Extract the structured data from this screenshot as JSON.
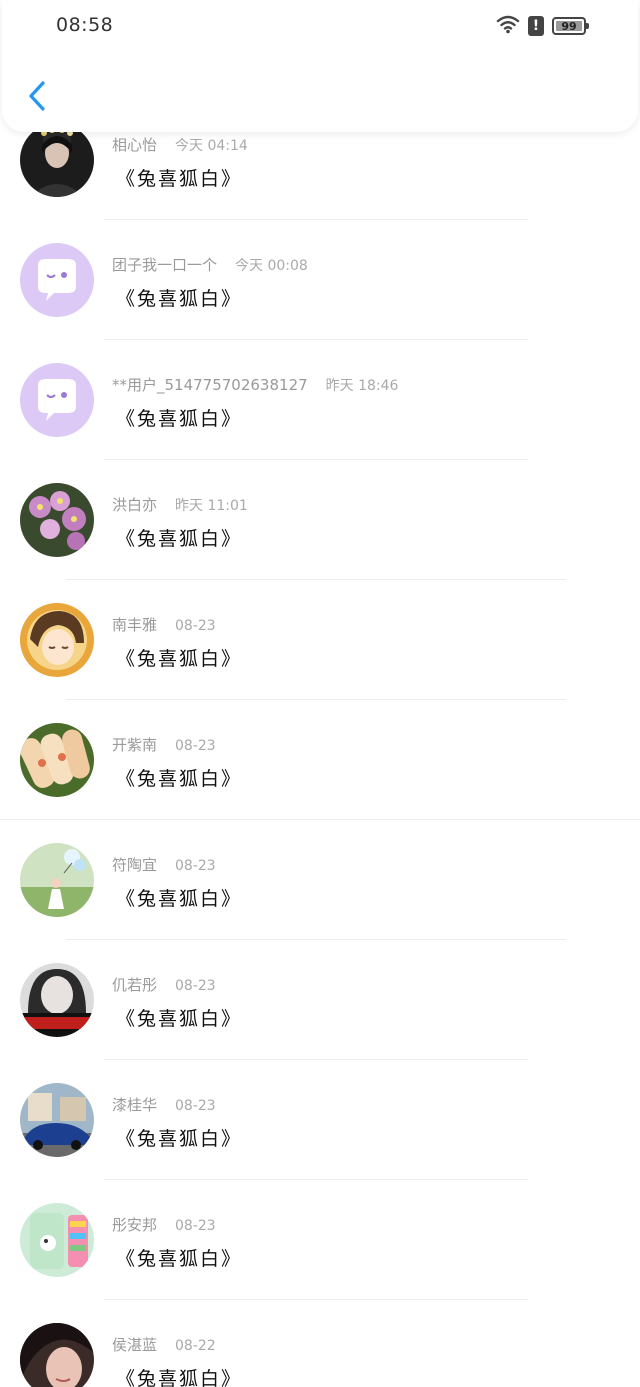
{
  "status_bar": {
    "time": "08:58",
    "battery": "99",
    "alert": "!"
  },
  "header": {
    "back_icon": "chevron-left-icon",
    "accent": "#2196f3"
  },
  "messages": [
    {
      "name": "相心怡",
      "time": "今天 04:14",
      "text": "《兔喜狐白》",
      "avatar": "dark-portrait"
    },
    {
      "name": "团子我一口一个",
      "time": "今天 00:08",
      "text": "《兔喜狐白》",
      "avatar": "purple-chat-icon"
    },
    {
      "name": "**用户_514775702638127",
      "time": "昨天 18:46",
      "text": "《兔喜狐白》",
      "avatar": "purple-chat-icon"
    },
    {
      "name": "洪白亦",
      "time": "昨天 11:01",
      "text": "《兔喜狐白》",
      "avatar": "orchid-photo"
    },
    {
      "name": "南丰雅",
      "time": "08-23",
      "text": "《兔喜狐白》",
      "avatar": "anime-girl"
    },
    {
      "name": "开紫南",
      "time": "08-23",
      "text": "《兔喜狐白》",
      "avatar": "spring-rolls-photo"
    },
    {
      "name": "符陶宜",
      "time": "08-23",
      "text": "《兔喜狐白》",
      "avatar": "girl-balloon-photo"
    },
    {
      "name": "仉若彤",
      "time": "08-23",
      "text": "《兔喜狐白》",
      "avatar": "bw-portrait-red-text"
    },
    {
      "name": "漆桂华",
      "time": "08-23",
      "text": "《兔喜狐白》",
      "avatar": "blue-car-photo"
    },
    {
      "name": "彤安邦",
      "time": "08-23",
      "text": "《兔喜狐白》",
      "avatar": "phone-case-photo"
    },
    {
      "name": "侯湛蓝",
      "time": "08-22",
      "text": "《兔喜狐白》",
      "avatar": "girl-closeup-photo"
    }
  ]
}
